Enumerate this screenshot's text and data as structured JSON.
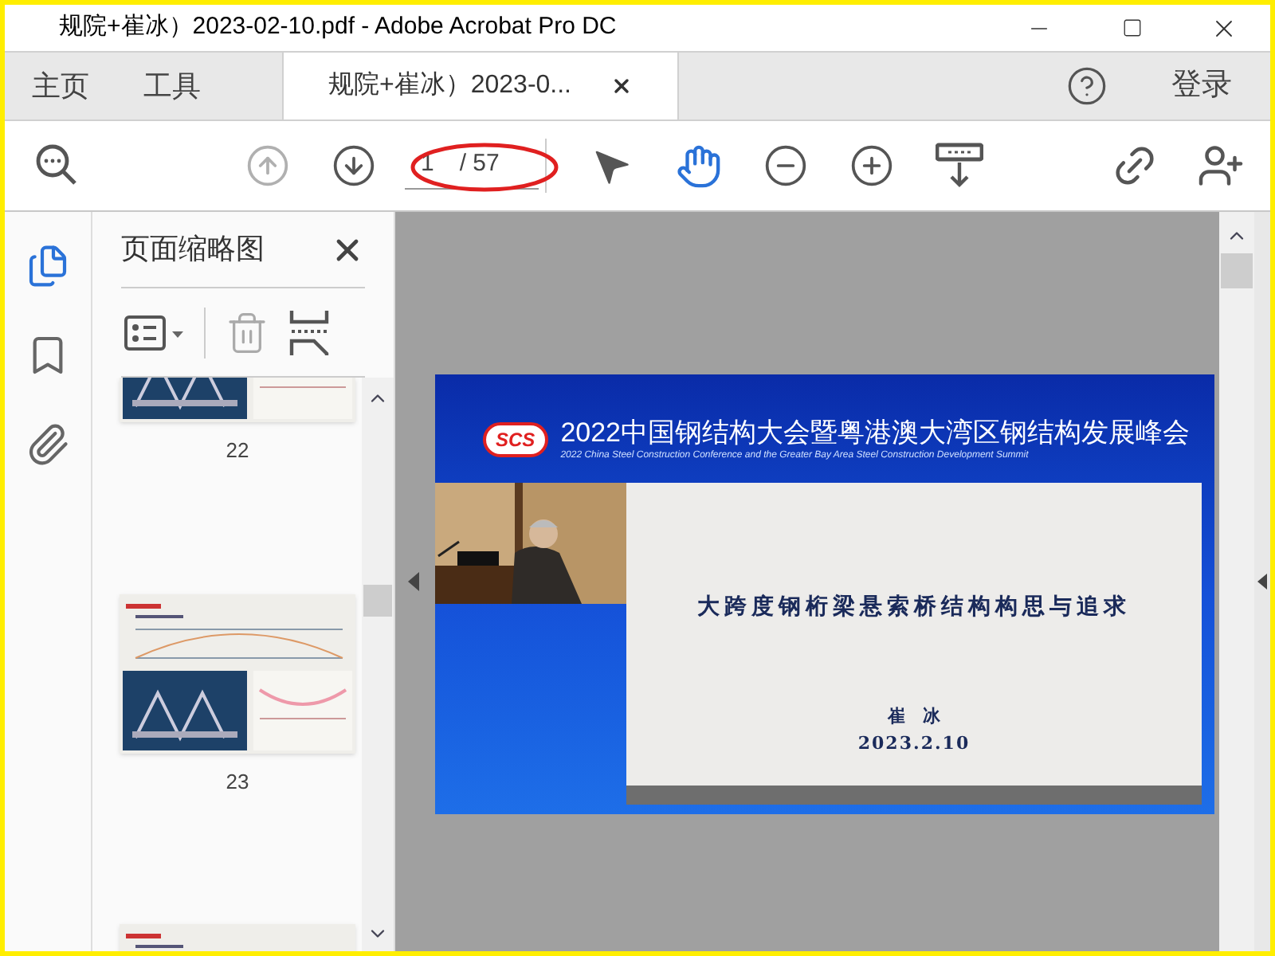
{
  "window": {
    "title": "规院+崔冰）2023-02-10.pdf - Adobe Acrobat Pro DC"
  },
  "tabs": [
    {
      "label": "主页",
      "selected": false
    },
    {
      "label": "工具",
      "selected": false
    },
    {
      "label": "规院+崔冰）2023-0...",
      "selected": true
    }
  ],
  "sign_in": "登录",
  "page_nav": [
    {
      "kind": "up",
      "disabled": true
    },
    {
      "kind": "down",
      "disabled": false
    }
  ],
  "page_field": {
    "value": "1",
    "total": "/ 57"
  },
  "tools": [
    {
      "kind": "pointer",
      "selected": false
    },
    {
      "kind": "hand",
      "selected": true
    }
  ],
  "rail": [
    {
      "kind": "pages",
      "selected": true
    },
    {
      "kind": "bookmarks",
      "selected": false
    },
    {
      "kind": "attachments",
      "selected": false
    }
  ],
  "panel": {
    "title": "页面缩略图",
    "thumbnails": [
      {
        "kind": "cut-top",
        "label": "22"
      },
      {
        "kind": "full",
        "label": "23"
      },
      {
        "kind": "cut-bottom"
      }
    ]
  },
  "slide": {
    "logo": "SCS",
    "banner_title": "2022中国钢结构大会暨粤港澳大湾区钢结构发展峰会",
    "banner_subtitle": "2022 China Steel Construction Conference and the Greater Bay Area Steel Construction Development Summit",
    "title": "大跨度钢桁梁悬索桥结构构思与追求",
    "author": "崔　冰",
    "date": "2023.2.10"
  }
}
